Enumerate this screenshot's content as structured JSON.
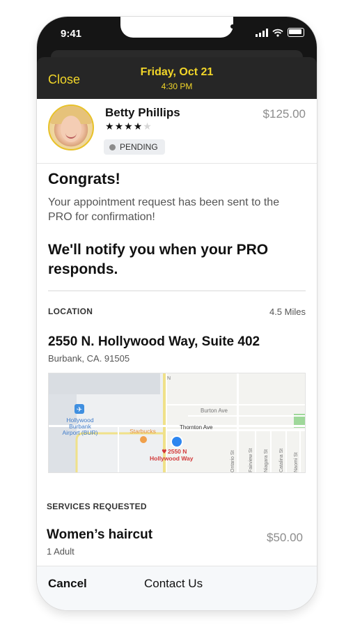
{
  "status_bar": {
    "time": "9:41"
  },
  "header": {
    "close_label": "Close",
    "date": "Friday, Oct 21",
    "time": "4:30 PM",
    "accent_color": "#f2d629"
  },
  "pro": {
    "name": "Betty Phillips",
    "rating": 4,
    "rating_max": 5,
    "price": "$125.00",
    "status": "PENDING"
  },
  "confirmation": {
    "title": "Congrats!",
    "message": "Your appointment request has been sent to the PRO for confirmation!",
    "notify": "We'll notify you when your PRO responds."
  },
  "location": {
    "label": "LOCATION",
    "distance": "4.5 Miles",
    "address": "2550 N. Hollywood Way, Suite 402",
    "city": "Burbank, CA. 91505",
    "map": {
      "airport_label_1": "Hollywood",
      "airport_label_2": "Burbank",
      "airport_label_3": "Airport (BUR)",
      "starbucks_label": "Starbucks",
      "pin_label_1": "2550 N",
      "pin_label_2": "Hollywood Way",
      "street_burton": "Burton Ave",
      "street_thornton": "Thornton Ave",
      "street_n": "N",
      "street_ontario": "Ontario St",
      "street_fairview": "Fairview St",
      "street_niagara": "Niagara St",
      "street_catalina": "Catalina St",
      "street_naomi": "Naomi St"
    }
  },
  "services": {
    "label": "SERVICES REQUESTED",
    "items": [
      {
        "name": "Women’s haircut",
        "quantity": "1 Adult",
        "price": "$50.00"
      }
    ]
  },
  "footer": {
    "cancel_label": "Cancel",
    "contact_label": "Contact Us"
  }
}
